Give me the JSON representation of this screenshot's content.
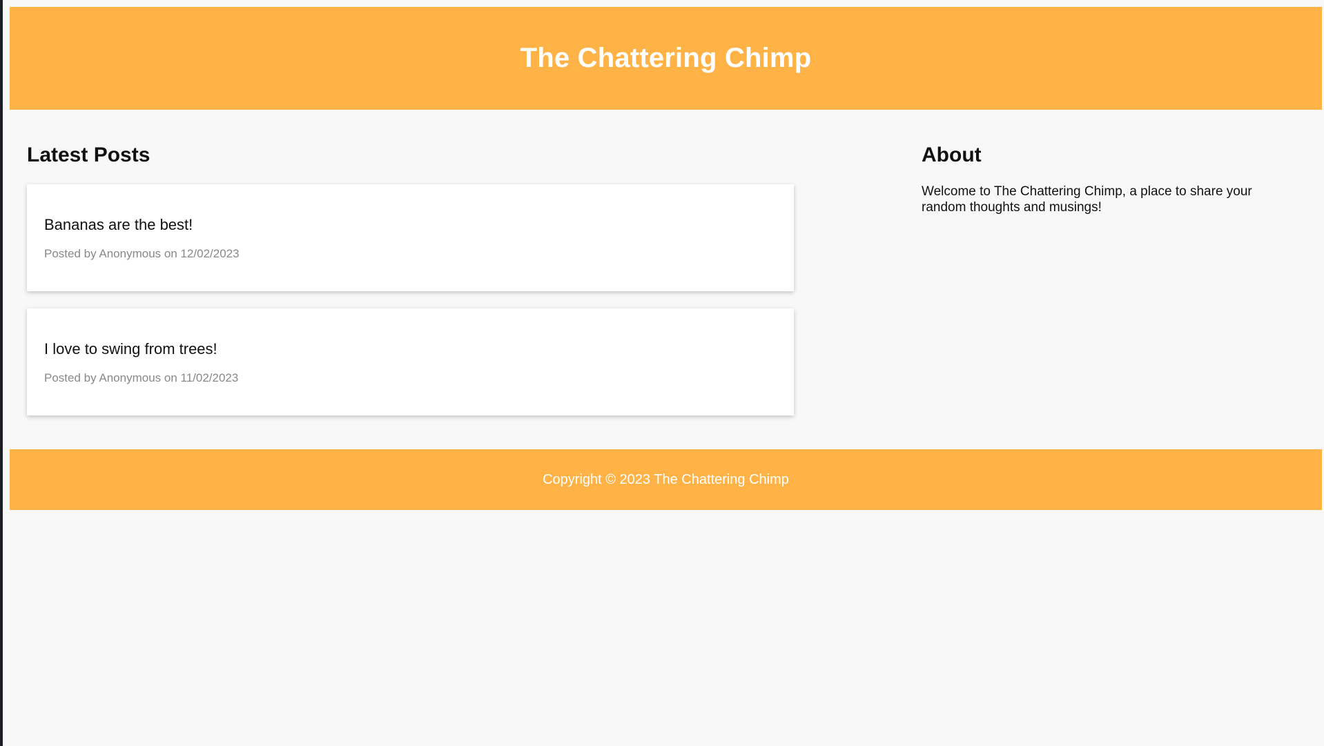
{
  "header": {
    "site_title": "The Chattering Chimp"
  },
  "posts_section": {
    "heading": "Latest Posts",
    "posts": [
      {
        "title": "Bananas are the best!",
        "meta": "Posted by Anonymous on 12/02/2023"
      },
      {
        "title": "I love to swing from trees!",
        "meta": "Posted by Anonymous on 11/02/2023"
      }
    ]
  },
  "about_section": {
    "heading": "About",
    "text": "Welcome to The Chattering Chimp, a place to share your random thoughts and musings!"
  },
  "footer": {
    "copyright": "Copyright © 2023 The Chattering Chimp"
  },
  "colors": {
    "header_bg": "#ffb347",
    "footer_bg": "#ffb347",
    "page_bg": "#f8f8f8"
  }
}
